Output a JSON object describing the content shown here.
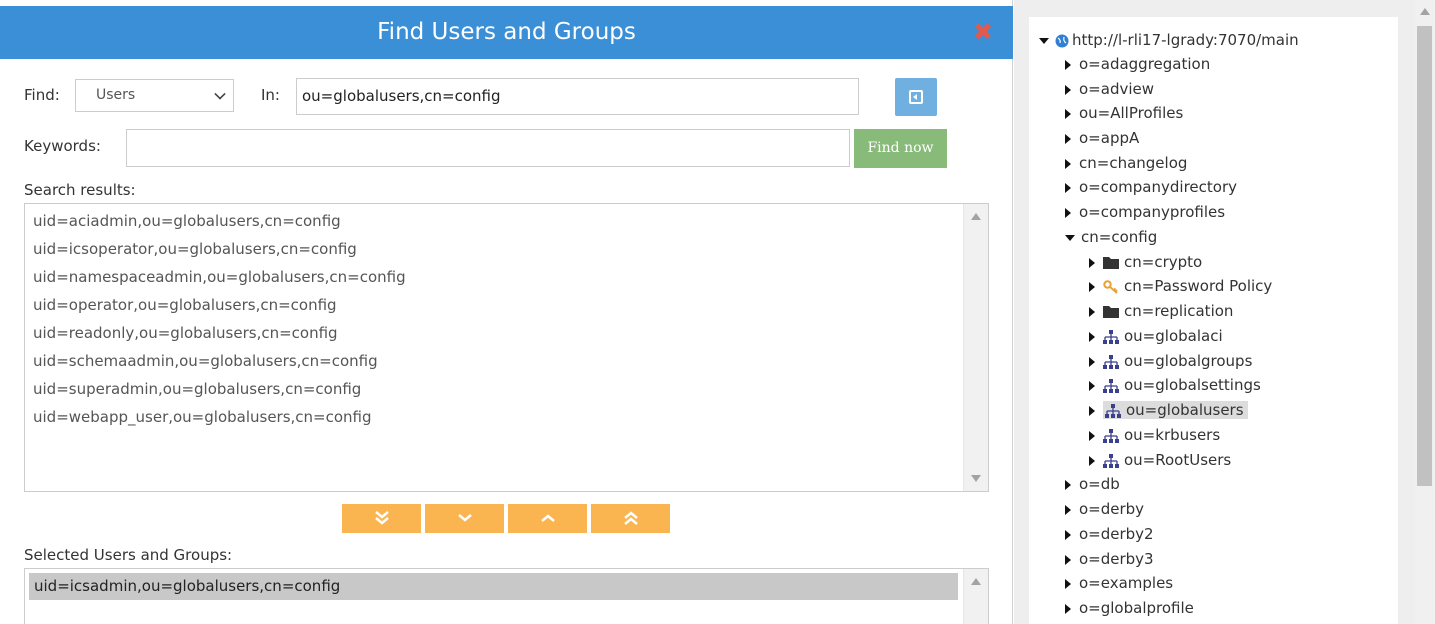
{
  "dialog": {
    "title": "Find Users and Groups",
    "find_label": "Find:",
    "find_value": "Users",
    "in_label": "In:",
    "in_value": "ou=globalusers,cn=config",
    "keywords_label": "Keywords:",
    "keywords_value": "",
    "find_now_label": "Find now",
    "results_label": "Search results:",
    "results": [
      "uid=aciadmin,ou=globalusers,cn=config",
      "uid=icsoperator,ou=globalusers,cn=config",
      "uid=namespaceadmin,ou=globalusers,cn=config",
      "uid=operator,ou=globalusers,cn=config",
      "uid=readonly,ou=globalusers,cn=config",
      "uid=schemaadmin,ou=globalusers,cn=config",
      "uid=superadmin,ou=globalusers,cn=config",
      "uid=webapp_user,ou=globalusers,cn=config"
    ],
    "selected_label": "Selected Users and Groups:",
    "selected": [
      "uid=icsadmin,ou=globalusers,cn=config"
    ]
  },
  "tree": {
    "root": "http://l-rli17-lgrady:7070/main",
    "top_items": [
      "o=adaggregation",
      "o=adview",
      "ou=AllProfiles",
      "o=appA",
      "cn=changelog",
      "o=companydirectory",
      "o=companyprofiles"
    ],
    "expanded": "cn=config",
    "children": [
      {
        "label": "cn=crypto",
        "icon": "folder-icon"
      },
      {
        "label": "cn=Password Policy",
        "icon": "key-icon"
      },
      {
        "label": "cn=replication",
        "icon": "folder-icon"
      },
      {
        "label": "ou=globalaci",
        "icon": "org-unit-icon"
      },
      {
        "label": "ou=globalgroups",
        "icon": "org-unit-icon"
      },
      {
        "label": "ou=globalsettings",
        "icon": "org-unit-icon"
      },
      {
        "label": "ou=globalusers",
        "icon": "org-unit-icon",
        "selected": true
      },
      {
        "label": "ou=krbusers",
        "icon": "org-unit-icon"
      },
      {
        "label": "ou=RootUsers",
        "icon": "org-unit-icon"
      }
    ],
    "bottom_items": [
      "o=db",
      "o=derby",
      "o=derby2",
      "o=derby3",
      "o=examples",
      "o=globalprofile"
    ]
  },
  "colors": {
    "header": "#3b8fd6",
    "find_now": "#88bb7a",
    "move_buttons": "#fab550",
    "close": "#e05a4e"
  }
}
